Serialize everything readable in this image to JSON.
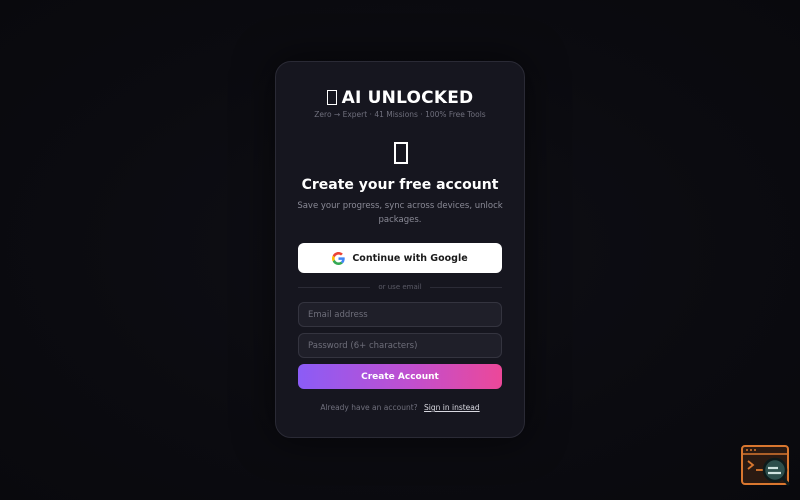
{
  "brand": {
    "title": "AI UNLOCKED",
    "subtitle": "Zero → Expert · 41 Missions · 100% Free Tools"
  },
  "signup": {
    "heading": "Create your free account",
    "description": "Save your progress, sync across devices, unlock packages.",
    "google_label": "Continue with Google",
    "divider_text": "or use email",
    "email_placeholder": "Email address",
    "password_placeholder": "Password (6+ characters)",
    "submit_label": "Create Account",
    "signin_prompt": "Already have an account?",
    "signin_link": "Sign in instead"
  },
  "colors": {
    "background": "#0b0b10",
    "card": "#16161f",
    "gradient_start": "#8b5cf6",
    "gradient_end": "#ec4899"
  },
  "icons": {
    "brand": "missing-glyph-icon",
    "hero": "missing-glyph-icon",
    "google": "google-logo-icon",
    "corner": "terminal-search-icon"
  }
}
